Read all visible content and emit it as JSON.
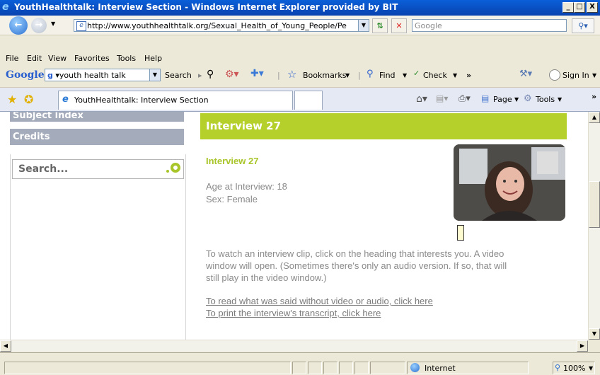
{
  "window": {
    "title": "YouthHealthtalk: Interview Section - Windows Internet Explorer provided by BIT",
    "minimize": "_",
    "maximize": "□",
    "close": "X"
  },
  "address": {
    "url": "http://www.youthhealthtalk.org/Sexual_Health_of_Young_People/Pe",
    "search_placeholder": "Google"
  },
  "menu": [
    "File",
    "Edit",
    "View",
    "Favorites",
    "Tools",
    "Help"
  ],
  "google_toolbar": {
    "logo": "Google",
    "query": "youth health talk",
    "search_label": "Search",
    "bookmarks_label": "Bookmarks",
    "find_label": "Find",
    "check_label": "Check",
    "more": "»",
    "signin_label": "Sign In"
  },
  "tabs": {
    "active_title": "YouthHealthtalk: Interview Section",
    "page_label": "Page",
    "tools_label": "Tools",
    "more": "»"
  },
  "sidebar": {
    "subject_index": "Subject index",
    "credits": "Credits",
    "search_placeholder": "Search..."
  },
  "main": {
    "banner_title": "Interview 27",
    "heading": "Interview 27",
    "age_line": "Age at Interview: 18",
    "sex_line": "Sex: Female",
    "instructions_1": "To watch an interview clip, click on the heading that interests you. A video",
    "instructions_2": "window will open. (Sometimes there's only an audio version. If so, that will",
    "instructions_3": "still play in the video window.)",
    "link_read": "To read what was said without video or audio, click here",
    "link_print": "To print the interview's transcript, click here"
  },
  "status": {
    "zone": "Internet",
    "zoom": "100%"
  },
  "colors": {
    "accent_green": "#b5cf2b",
    "sidebar_grey": "#a4abba",
    "title_blue": "#0a5fd8"
  }
}
